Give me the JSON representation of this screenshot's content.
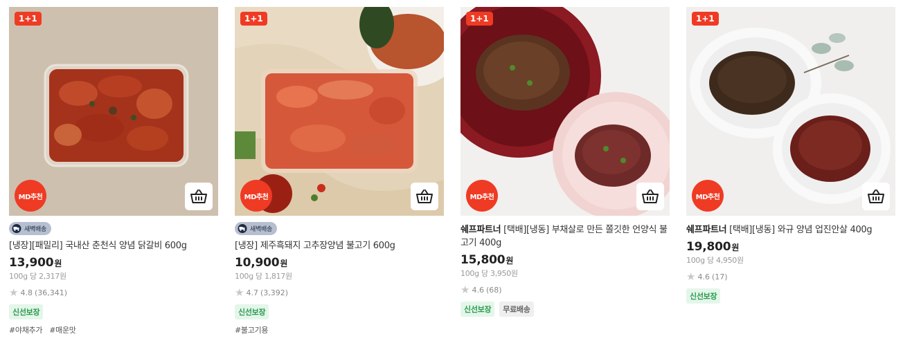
{
  "products": [
    {
      "promo_badge": "1+1",
      "md_badge": "MD추천",
      "delivery_tag": "새벽배송",
      "brand": "",
      "title": "[냉장][패밀리] 국내산 춘천식 양념 닭갈비 600g",
      "price": "13,900",
      "currency": "원",
      "unit_price": "100g 당 2,317원",
      "rating": "4.8",
      "review_count": "(36,341)",
      "tags": [
        "신선보장"
      ],
      "hashtags": [
        "#야채추가",
        "#매운맛"
      ]
    },
    {
      "promo_badge": "1+1",
      "md_badge": "MD추천",
      "delivery_tag": "새벽배송",
      "brand": "",
      "title": "[냉장] 제주흑돼지 고추장양념 불고기 600g",
      "price": "10,900",
      "currency": "원",
      "unit_price": "100g 당 1,817원",
      "rating": "4.7",
      "review_count": "(3,392)",
      "tags": [
        "신선보장"
      ],
      "hashtags": [
        "#불고기용"
      ]
    },
    {
      "promo_badge": "1+1",
      "md_badge": "MD추천",
      "delivery_tag": "",
      "brand": "쉐프파트너",
      "title": "[택배][냉동] 부채살로 만든 쫄깃한 언양식 불고기 400g",
      "price": "15,800",
      "currency": "원",
      "unit_price": "100g 당 3,950원",
      "rating": "4.6",
      "review_count": "(68)",
      "tags": [
        "신선보장",
        "무료배송"
      ],
      "hashtags": []
    },
    {
      "promo_badge": "1+1",
      "md_badge": "MD추천",
      "delivery_tag": "",
      "brand": "쉐프파트너",
      "title": "[택배][냉동] 와규 양념 업진안살 400g",
      "price": "19,800",
      "currency": "원",
      "unit_price": "100g 당 4,950원",
      "rating": "4.6",
      "review_count": "(17)",
      "tags": [
        "신선보장"
      ],
      "hashtags": []
    }
  ],
  "icons": {
    "cart": "basket-icon",
    "star": "star-icon",
    "truck": "truck-icon"
  },
  "colors": {
    "accent": "#ef3b24",
    "fresh_tag_bg": "#e4f6ea",
    "fresh_tag_text": "#2c9a4f",
    "dawn_tag_bg": "#b5bfcf"
  }
}
